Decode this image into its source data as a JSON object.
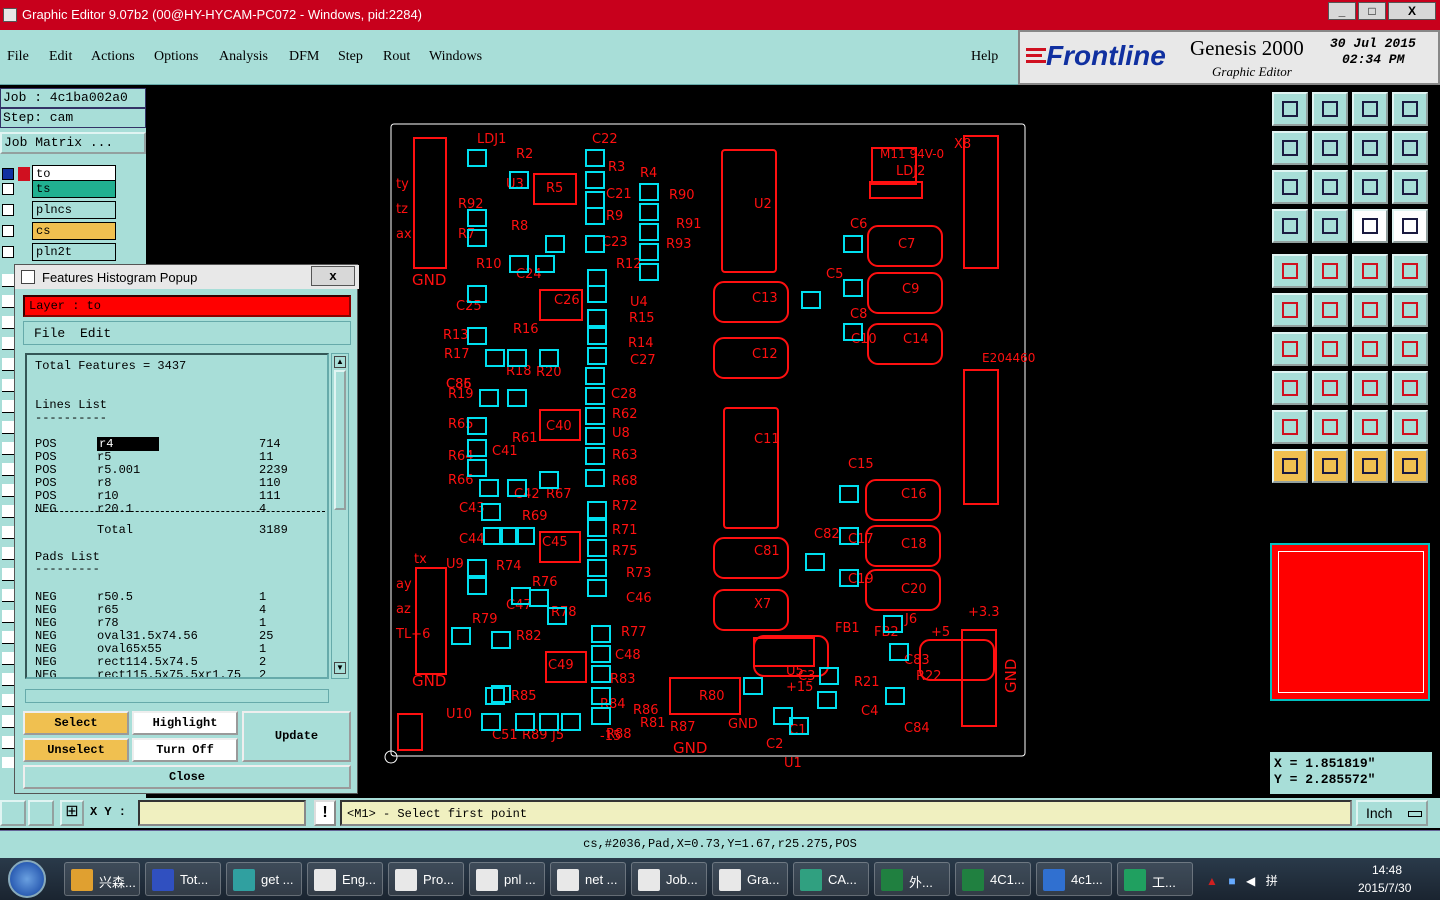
{
  "window": {
    "title": "Graphic Editor 9.07b2 (00@HY-HYCAM-PC072 - Windows, pid:2284)",
    "minimize": "_",
    "maximize": "□",
    "close": "X"
  },
  "menu": {
    "items": [
      "File",
      "Edit",
      "Actions",
      "Options",
      "Analysis",
      "DFM",
      "Step",
      "Rout",
      "Windows"
    ],
    "help": "Help"
  },
  "brand": {
    "logo": "Frontline",
    "product": "Genesis 2000",
    "subtitle": "Graphic Editor",
    "date": "30 Jul 2015",
    "time": "02:34 PM"
  },
  "job": {
    "job_line": "Job : 4c1ba002a0",
    "step_line": "Step: cam",
    "matrix_button": "Job Matrix ..."
  },
  "layers": [
    {
      "name": "to",
      "color": "#ffffff"
    },
    {
      "name": "ts",
      "color": "#20b090"
    },
    {
      "name": "plncs",
      "color": "#a8ded8"
    },
    {
      "name": "cs",
      "color": "#f0c050"
    },
    {
      "name": "pln2t",
      "color": "#a8ded8"
    }
  ],
  "popup": {
    "title": "Features Histogram Popup",
    "close": "x",
    "layer_label": "Layer : to",
    "menu_file": "File",
    "menu_edit": "Edit",
    "total_features": "Total Features = 3437",
    "lines_header": "Lines List",
    "lines": [
      {
        "pol": "POS",
        "sym": "r4",
        "count": "714"
      },
      {
        "pol": "POS",
        "sym": "r5",
        "count": "11"
      },
      {
        "pol": "POS",
        "sym": "r5.001",
        "count": "2239"
      },
      {
        "pol": "POS",
        "sym": "r8",
        "count": "110"
      },
      {
        "pol": "POS",
        "sym": "r10",
        "count": "111"
      },
      {
        "pol": "NEG",
        "sym": "r20.1",
        "count": "4"
      }
    ],
    "total_label": "Total",
    "total_value": "3189",
    "pads_header": "Pads List",
    "pads": [
      {
        "pol": "NEG",
        "sym": "r50.5",
        "count": "1"
      },
      {
        "pol": "NEG",
        "sym": "r65",
        "count": "4"
      },
      {
        "pol": "NEG",
        "sym": "r78",
        "count": "1"
      },
      {
        "pol": "NEG",
        "sym": "oval31.5x74.56",
        "count": "25"
      },
      {
        "pol": "NEG",
        "sym": "oval65x55",
        "count": "1"
      },
      {
        "pol": "NEG",
        "sym": "rect114.5x74.5",
        "count": "2"
      },
      {
        "pol": "NEG",
        "sym": "rect115.5x75.5xr1.75",
        "count": "2"
      }
    ],
    "select": "Select",
    "unselect": "Unselect",
    "highlight": "Highlight",
    "turn_off": "Turn Off",
    "update": "Update",
    "close_btn": "Close"
  },
  "pcb": {
    "labels_red": [
      "LDJ1",
      "R2",
      "C22",
      "R5",
      "U3",
      "R3",
      "C21",
      "R4",
      "R90",
      "R91",
      "R93",
      "R92",
      "R7",
      "R8",
      "R9",
      "C23",
      "R10",
      "C24",
      "R12",
      "C26",
      "C25",
      "U4",
      "R16",
      "R15",
      "R13",
      "R14",
      "R17",
      "C27",
      "R18",
      "R20",
      "R19",
      "C28",
      "R62",
      "R65",
      "C40",
      "R61",
      "U8",
      "C41",
      "R64",
      "R63",
      "R66",
      "C42",
      "R67",
      "R68",
      "C43",
      "R69",
      "R72",
      "C44",
      "R71",
      "C45",
      "R75",
      "U9",
      "R74",
      "R76",
      "R73",
      "R78",
      "C46",
      "C47",
      "R79",
      "R77",
      "R82",
      "C49",
      "C48",
      "R83",
      "U10",
      "R85",
      "R84",
      "R86",
      "R80",
      "R81",
      "R87",
      "R88",
      "C51",
      "R89",
      "J5",
      "-15",
      "+15",
      "GND",
      "C1",
      "C2",
      "U1",
      "U2",
      "C11",
      "C13",
      "C12",
      "C5",
      "C6",
      "C7",
      "C8",
      "C9",
      "C10",
      "C14",
      "C15",
      "C16",
      "C17",
      "C18",
      "C19",
      "C20",
      "C81",
      "C82",
      "X7",
      "X8",
      "E204460",
      "M11 94V-0",
      "LDJ2",
      "tx",
      "ty",
      "tz",
      "ax",
      "ay",
      "az",
      "TL+6",
      "FB1",
      "FB2",
      "J6",
      "+5",
      "+3.3",
      "U5",
      "C3",
      "C4",
      "R21",
      "R22",
      "C83",
      "C84",
      "C85",
      "C86"
    ],
    "labels_gnd": [
      "GND",
      "GND",
      "GND"
    ]
  },
  "coords": {
    "x": "X = 1.851819\"",
    "y": "Y = 2.285572\""
  },
  "bottom": {
    "xy_label": "X Y :",
    "xy_value": "",
    "prompt": "<M1> - Select first point",
    "units": "Inch",
    "exclaim": "!"
  },
  "status": "cs,#2036,Pad,X=0.73,Y=1.67,r25.275,POS",
  "taskbar": {
    "items": [
      {
        "label": "兴森...",
        "color": "#e0a030"
      },
      {
        "label": "Tot...",
        "color": "#3050c0"
      },
      {
        "label": "get ...",
        "color": "#30a0a0"
      },
      {
        "label": "Eng...",
        "color": "#e8e8e8"
      },
      {
        "label": "Pro...",
        "color": "#e8e8e8"
      },
      {
        "label": "pnl ...",
        "color": "#e8e8e8"
      },
      {
        "label": "net ...",
        "color": "#e8e8e8"
      },
      {
        "label": "Job...",
        "color": "#e8e8e8"
      },
      {
        "label": "Gra...",
        "color": "#e8e8e8"
      },
      {
        "label": "CA...",
        "color": "#30a080"
      },
      {
        "label": "外...",
        "color": "#208040"
      },
      {
        "label": "4C1...",
        "color": "#208040"
      },
      {
        "label": "4c1...",
        "color": "#3070d0"
      },
      {
        "label": "工...",
        "color": "#20a060"
      }
    ],
    "clock_time": "14:48",
    "clock_date": "2015/7/30"
  }
}
